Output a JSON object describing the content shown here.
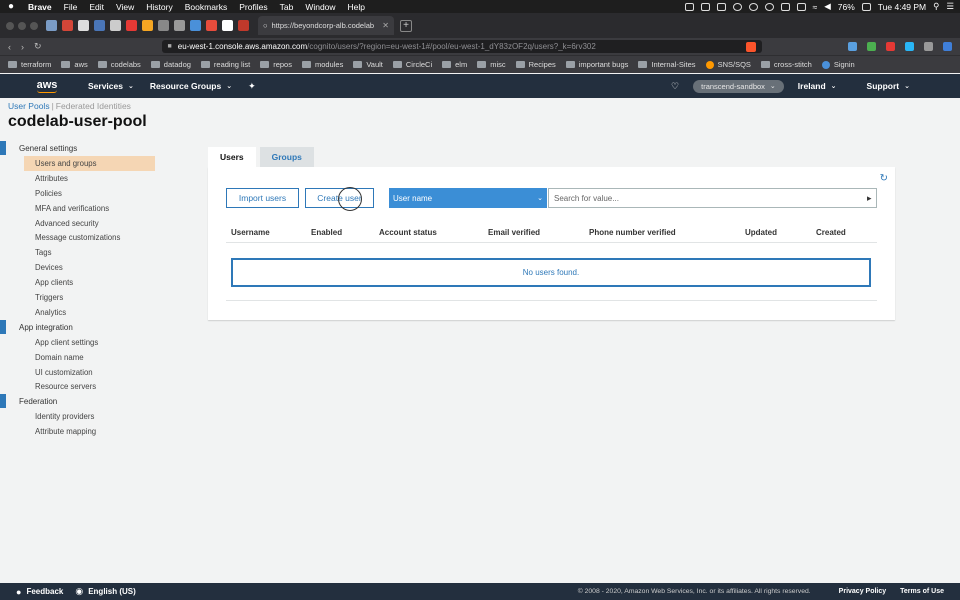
{
  "menubar": {
    "app": "Brave",
    "items": [
      "File",
      "Edit",
      "View",
      "History",
      "Bookmarks",
      "Profiles",
      "Tab",
      "Window",
      "Help"
    ],
    "battery": "76%",
    "clock": "Tue 4:49 PM"
  },
  "browser": {
    "active_tab_title": "https://beyondcorp-alb.codelab",
    "url_host": "eu-west-1.console.aws.amazon.com",
    "url_path": "/cognito/users/?region=eu-west-1#/pool/eu-west-1_dY83zOF2q/users?_k=6rv302"
  },
  "bookmarks": [
    {
      "label": "terraform",
      "kind": "folder"
    },
    {
      "label": "aws",
      "kind": "folder"
    },
    {
      "label": "codelabs",
      "kind": "folder"
    },
    {
      "label": "datadog",
      "kind": "folder"
    },
    {
      "label": "reading list",
      "kind": "folder"
    },
    {
      "label": "repos",
      "kind": "folder"
    },
    {
      "label": "modules",
      "kind": "folder"
    },
    {
      "label": "Vault",
      "kind": "folder"
    },
    {
      "label": "CircleCi",
      "kind": "folder"
    },
    {
      "label": "elm",
      "kind": "folder"
    },
    {
      "label": "misc",
      "kind": "folder"
    },
    {
      "label": "Recipes",
      "kind": "folder"
    },
    {
      "label": "important bugs",
      "kind": "folder"
    },
    {
      "label": "Internal-Sites",
      "kind": "folder"
    },
    {
      "label": "SNS/SQS",
      "kind": "site",
      "color": "#ff9900"
    },
    {
      "label": "cross-stitch",
      "kind": "folder"
    },
    {
      "label": "Signin",
      "kind": "site",
      "color": "#4a90d9"
    }
  ],
  "aws_header": {
    "logo": "aws",
    "services": "Services",
    "resource_groups": "Resource Groups",
    "account": "transcend-sandbox",
    "region": "Ireland",
    "support": "Support"
  },
  "breadcrumb": {
    "user_pools": "User Pools",
    "separator": "|",
    "federated": "Federated Identities"
  },
  "page_title": "codelab-user-pool",
  "sidebar": [
    {
      "section": "General settings",
      "items": [
        "Users and groups",
        "Attributes",
        "Policies",
        "MFA and verifications",
        "Advanced security",
        "Message customizations",
        "Tags",
        "Devices",
        "App clients",
        "Triggers",
        "Analytics"
      ]
    },
    {
      "section": "App integration",
      "items": [
        "App client settings",
        "Domain name",
        "UI customization",
        "Resource servers"
      ]
    },
    {
      "section": "Federation",
      "items": [
        "Identity providers",
        "Attribute mapping"
      ]
    }
  ],
  "tabs": {
    "users": "Users",
    "groups": "Groups"
  },
  "panel": {
    "import_button": "Import users",
    "create_button": "Create user",
    "attribute_select": "User name",
    "search_placeholder": "Search for value...",
    "columns": [
      "Username",
      "Enabled",
      "Account status",
      "Email verified",
      "Phone number verified",
      "Updated",
      "Created"
    ],
    "empty_message": "No users found."
  },
  "footer": {
    "feedback": "Feedback",
    "language": "English (US)",
    "copyright": "© 2008 - 2020, Amazon Web Services, Inc. or its affiliates. All rights reserved.",
    "privacy": "Privacy Policy",
    "terms": "Terms of Use"
  },
  "colors": {
    "aws_header": "#232f3e",
    "link_blue": "#2e78b8",
    "active_nav": "#f5d6b4",
    "select_blue": "#3b8ed6"
  }
}
